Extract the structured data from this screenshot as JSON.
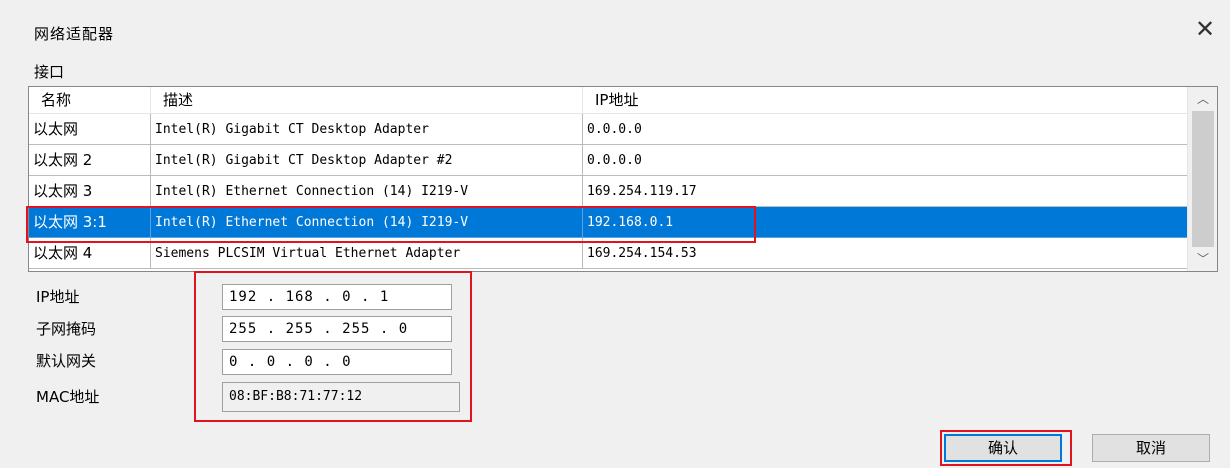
{
  "dialog": {
    "title": "网络适配器",
    "close_icon": "close-icon"
  },
  "interface_group": {
    "label": "接口",
    "columns": [
      "名称",
      "描述",
      "IP地址"
    ],
    "rows": [
      {
        "name": "以太网",
        "description": "Intel(R) Gigabit CT Desktop Adapter",
        "ip": "0.0.0.0"
      },
      {
        "name": "以太网 2",
        "description": "Intel(R) Gigabit CT Desktop Adapter #2",
        "ip": "0.0.0.0"
      },
      {
        "name": "以太网 3",
        "description": "Intel(R) Ethernet Connection (14) I219-V",
        "ip": "169.254.119.17"
      },
      {
        "name": "以太网 3:1",
        "description": "Intel(R) Ethernet Connection (14) I219-V",
        "ip": "192.168.0.1",
        "selected": true
      },
      {
        "name": "以太网 4",
        "description": "Siemens PLCSIM Virtual Ethernet Adapter",
        "ip": "169.254.154.53"
      }
    ]
  },
  "fields": {
    "ip_label": "IP地址",
    "ip_value": "192 . 168 .  0  .  1",
    "subnet_label": "子网掩码",
    "subnet_value": "255 . 255 . 255 .  0",
    "gateway_label": "默认网关",
    "gateway_value": " 0  .  0  .  0  .  0",
    "mac_label": "MAC地址",
    "mac_value": "08:BF:B8:71:77:12"
  },
  "buttons": {
    "ok": "确认",
    "cancel": "取消"
  },
  "colors": {
    "selection": "#0078d7",
    "highlight_box": "#e0141e"
  }
}
